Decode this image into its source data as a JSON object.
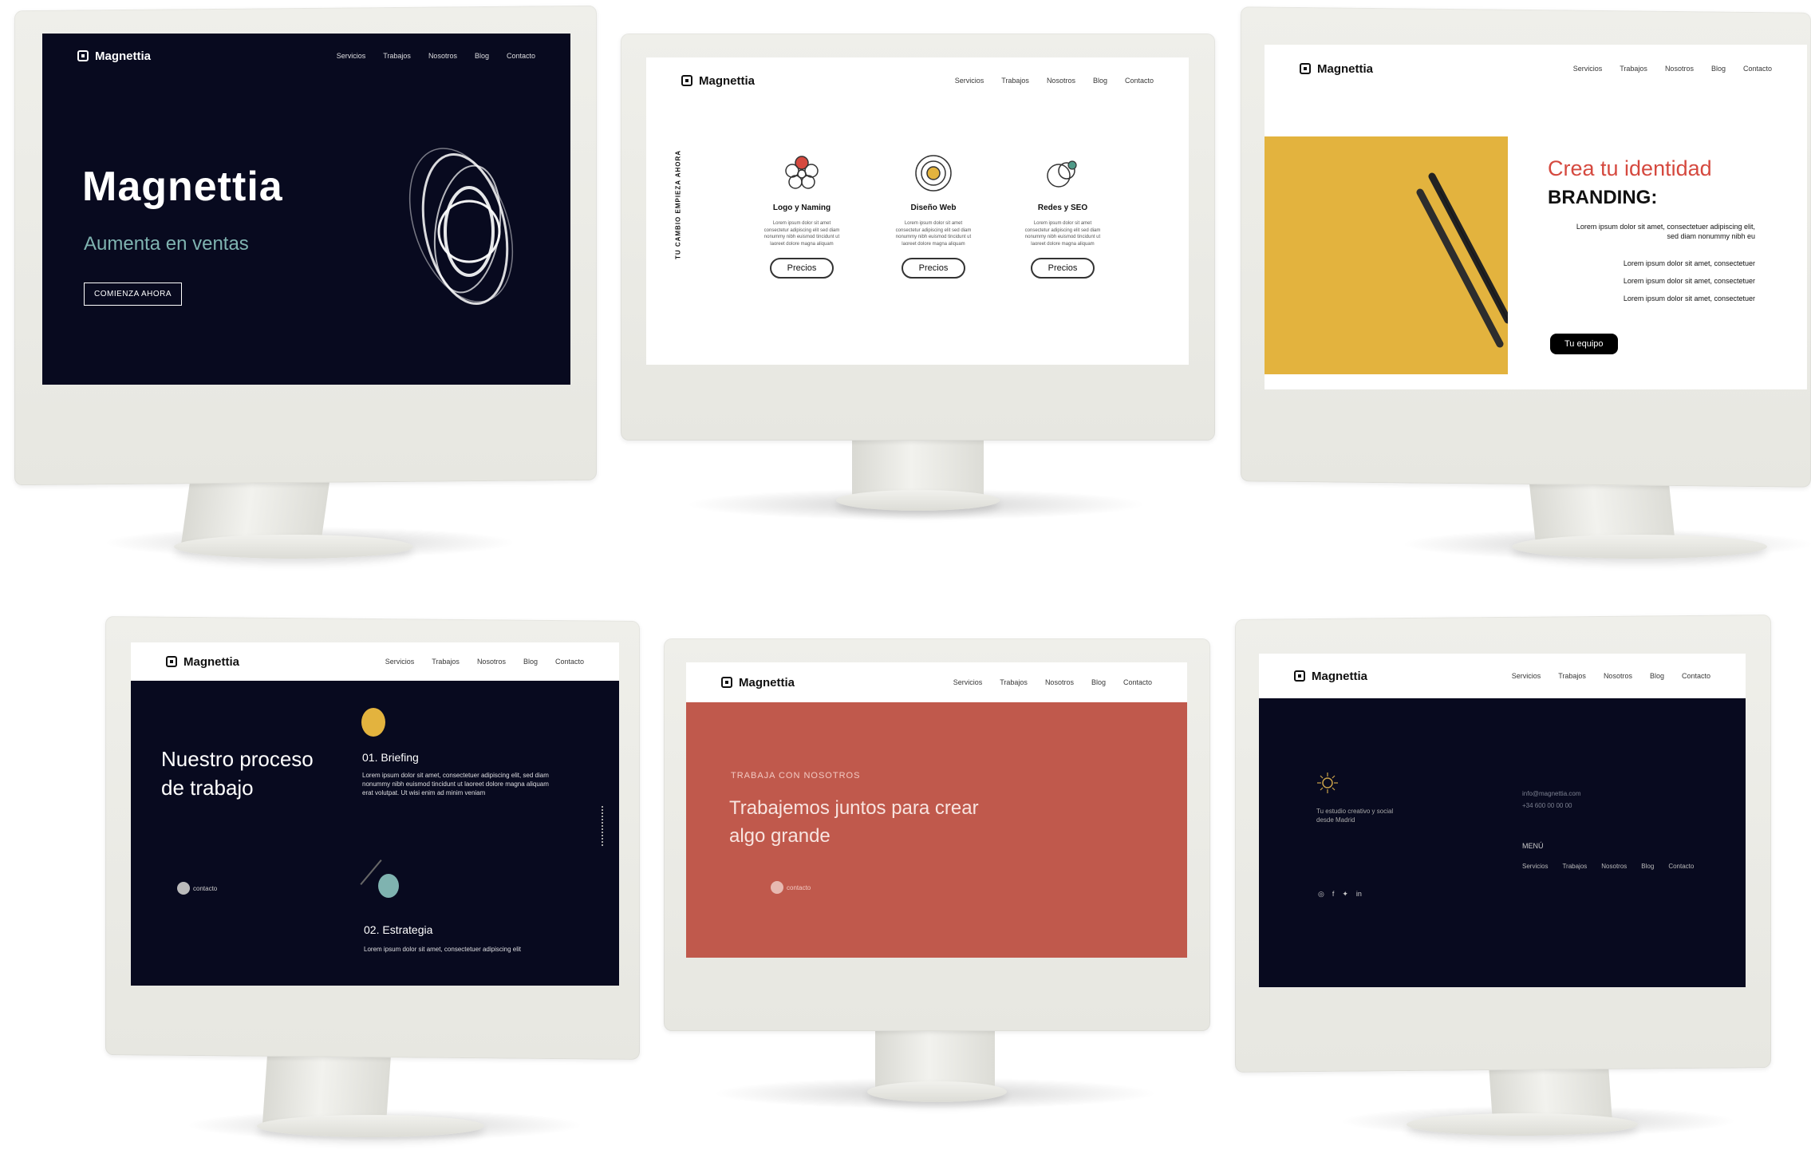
{
  "brand": "Magnettia",
  "nav": [
    "Servicios",
    "Trabajos",
    "Nosotros",
    "Blog",
    "Contacto"
  ],
  "colors": {
    "navy": "#080a1f",
    "coral": "#c0594c",
    "mustard": "#e3b33e",
    "red_accent": "#d5493f",
    "frame": "#e9e9e4"
  },
  "screen1": {
    "title": "Magnettia",
    "subtitle": "Aumenta en ventas",
    "cta": "COMIENZA AHORA"
  },
  "screen2": {
    "vertical_text": "TU CAMBIO EMPIEZA AHORA",
    "services": [
      {
        "title": "Logo y Naming",
        "text": "Lorem ipsum dolor sit amet consectetur adipiscing elit sed diam nonummy nibh euismod tincidunt ut laoreet dolore magna aliquam",
        "button": "Precios",
        "icon": "flower-icon"
      },
      {
        "title": "Diseño Web",
        "text": "Lorem ipsum dolor sit amet consectetur adipiscing elit sed diam nonummy nibh euismod tincidunt ut laoreet dolore magna aliquam",
        "button": "Precios",
        "icon": "target-icon"
      },
      {
        "title": "Redes y SEO",
        "text": "Lorem ipsum dolor sit amet consectetur adipiscing elit sed diam nonummy nibh euismod tincidunt ut laoreet dolore magna aliquam",
        "button": "Precios",
        "icon": "circles-icon"
      }
    ]
  },
  "screen3": {
    "heading_red": "Crea tu identidad",
    "heading_black": "BRANDING:",
    "intro": "Lorem ipsum dolor sit amet, consectetuer adipiscing elit, sed diam nonummy nibh eu",
    "lines": [
      "Lorem ipsum dolor sit amet, consectetuer",
      "Lorem ipsum dolor sit amet, consectetuer",
      "Lorem ipsum dolor sit amet, consectetuer"
    ],
    "button": "Tu equipo"
  },
  "screen4": {
    "heading_line1": "Nuestro proceso",
    "heading_line2": "de trabajo",
    "step1_title": "01. Briefing",
    "step1_text": "Lorem ipsum dolor sit amet, consectetuer adipiscing elit, sed diam nonummy nibh euismod tincidunt ut laoreet dolore magna aliquam erat volutpat. Ut wisi enim ad minim veniam",
    "contact_label": "contacto",
    "step2_title": "02. Estrategia",
    "step2_text": "Lorem ipsum dolor sit amet, consectetuer adipiscing elit"
  },
  "screen5": {
    "kicker": "TRABAJA CON NOSOTROS",
    "heading_line1": "Trabajemos juntos para crear",
    "heading_line2": "algo grande",
    "contact_label": "contacto"
  },
  "screen6": {
    "tagline_line1": "Tu estudio creativo y social",
    "tagline_line2": "desde Madrid",
    "contact_line1": "info@magnettia.com",
    "contact_line2": "+34 600 00 00 00",
    "menu_title": "MENÚ",
    "menu": [
      "Servicios",
      "Trabajos",
      "Nosotros",
      "Blog",
      "Contacto"
    ]
  }
}
